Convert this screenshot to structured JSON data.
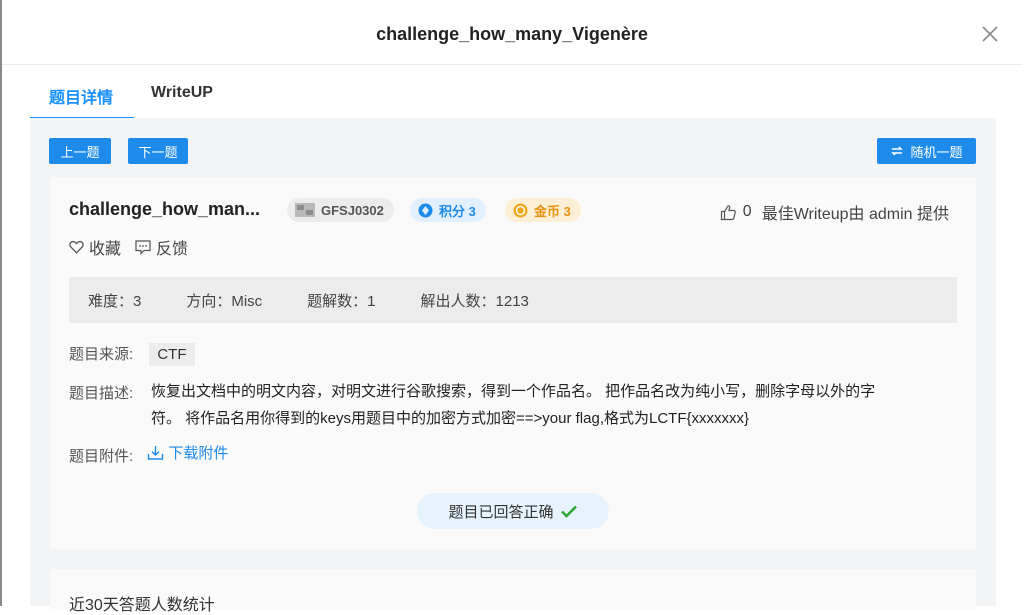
{
  "modal": {
    "title": "challenge_how_many_Vigenère"
  },
  "tabs": [
    {
      "label": "题目详情"
    },
    {
      "label": "WriteUP"
    }
  ],
  "nav": {
    "prev_label": "上一题",
    "next_label": "下一题",
    "random_label": "随机一题"
  },
  "problem": {
    "title": "challenge_how_man...",
    "id": "GFSJ0302",
    "points": "积分 3",
    "coins": "金币 3",
    "likes": "0",
    "writeup_credit": "最佳Writeup由 admin 提供",
    "favorite_label": "收藏",
    "feedback_label": "反馈"
  },
  "stats": {
    "difficulty": "难度：3",
    "direction": "方向：Misc",
    "solves": "题解数：1",
    "solvers": "解出人数：1213"
  },
  "details": {
    "source_label": "题目来源:",
    "source_value": "CTF",
    "desc_label": "题目描述:",
    "desc_line1": "恢复出文档中的明文内容，对明文进行谷歌搜索，得到一个作品名。 把作品名改为纯小写，删除字母以外的字",
    "desc_line2": "符。 将作品名用你得到的keys用题目中的加密方式加密==>your flag,格式为LCTF{xxxxxxx}",
    "attachment_label": "题目附件:",
    "download_label": "下载附件"
  },
  "status": {
    "answered_label": "题目已回答正确"
  },
  "stats_card": {
    "title": "近30天答题人数统计"
  },
  "colors": {
    "accent": "#1890ff",
    "button": "#1e8bea",
    "success": "#2eaa3a",
    "coin": "#e8920d"
  },
  "icons": [
    "close-icon",
    "id-icon",
    "points-icon",
    "coin-icon",
    "thumb-up-icon",
    "heart-icon",
    "feedback-icon",
    "download-icon",
    "check-icon",
    "refresh-icon"
  ]
}
